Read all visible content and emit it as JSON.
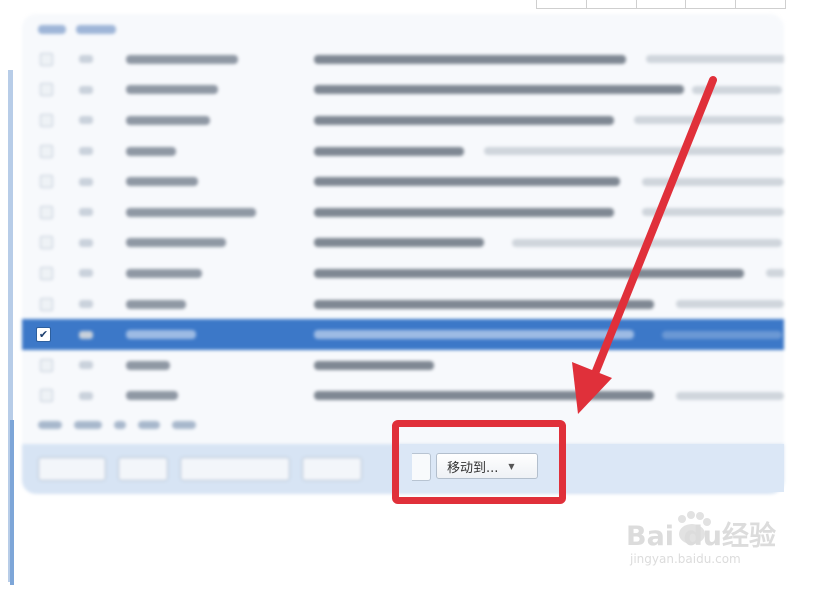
{
  "toolbar": {
    "move_to_label": "移动到...",
    "move_to_caret": "▼"
  },
  "message_list": {
    "selected_row_checkbox": "✔"
  },
  "annotation": {
    "highlight_color": "#e0303a",
    "arrow_color": "#e0303a"
  },
  "watermark": {
    "brand_text": "Bai du经验",
    "logo_icon": "paw-icon",
    "site_text": "jingyan.baidu.com"
  }
}
